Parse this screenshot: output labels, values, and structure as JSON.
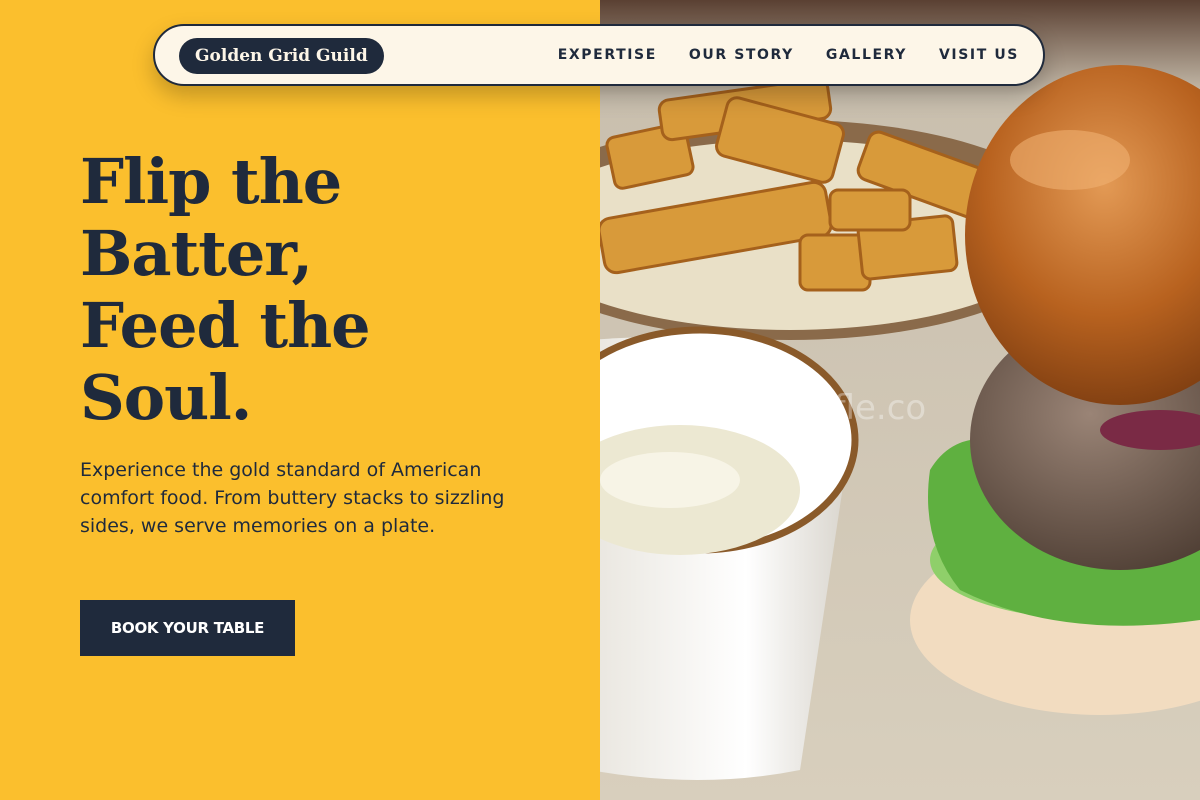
{
  "brand": {
    "name": "Golden Grid Guild"
  },
  "nav": {
    "items": [
      {
        "label": "EXPERTISE"
      },
      {
        "label": "OUR STORY"
      },
      {
        "label": "GALLERY"
      },
      {
        "label": "VISIT US"
      }
    ]
  },
  "hero": {
    "headline_lines": [
      "Flip the",
      "Batter,",
      "Feed the",
      "Soul."
    ],
    "description": "Experience the gold standard of American comfort food. From buttery stacks to sizzling sides, we serve memories on a plate.",
    "cta_label": "BOOK YOUR TABLE",
    "watermark": "tywaffle.co"
  },
  "colors": {
    "accent": "#fbbf2d",
    "dark": "#1f2a3c",
    "nav_bg": "#fdf6e8"
  }
}
